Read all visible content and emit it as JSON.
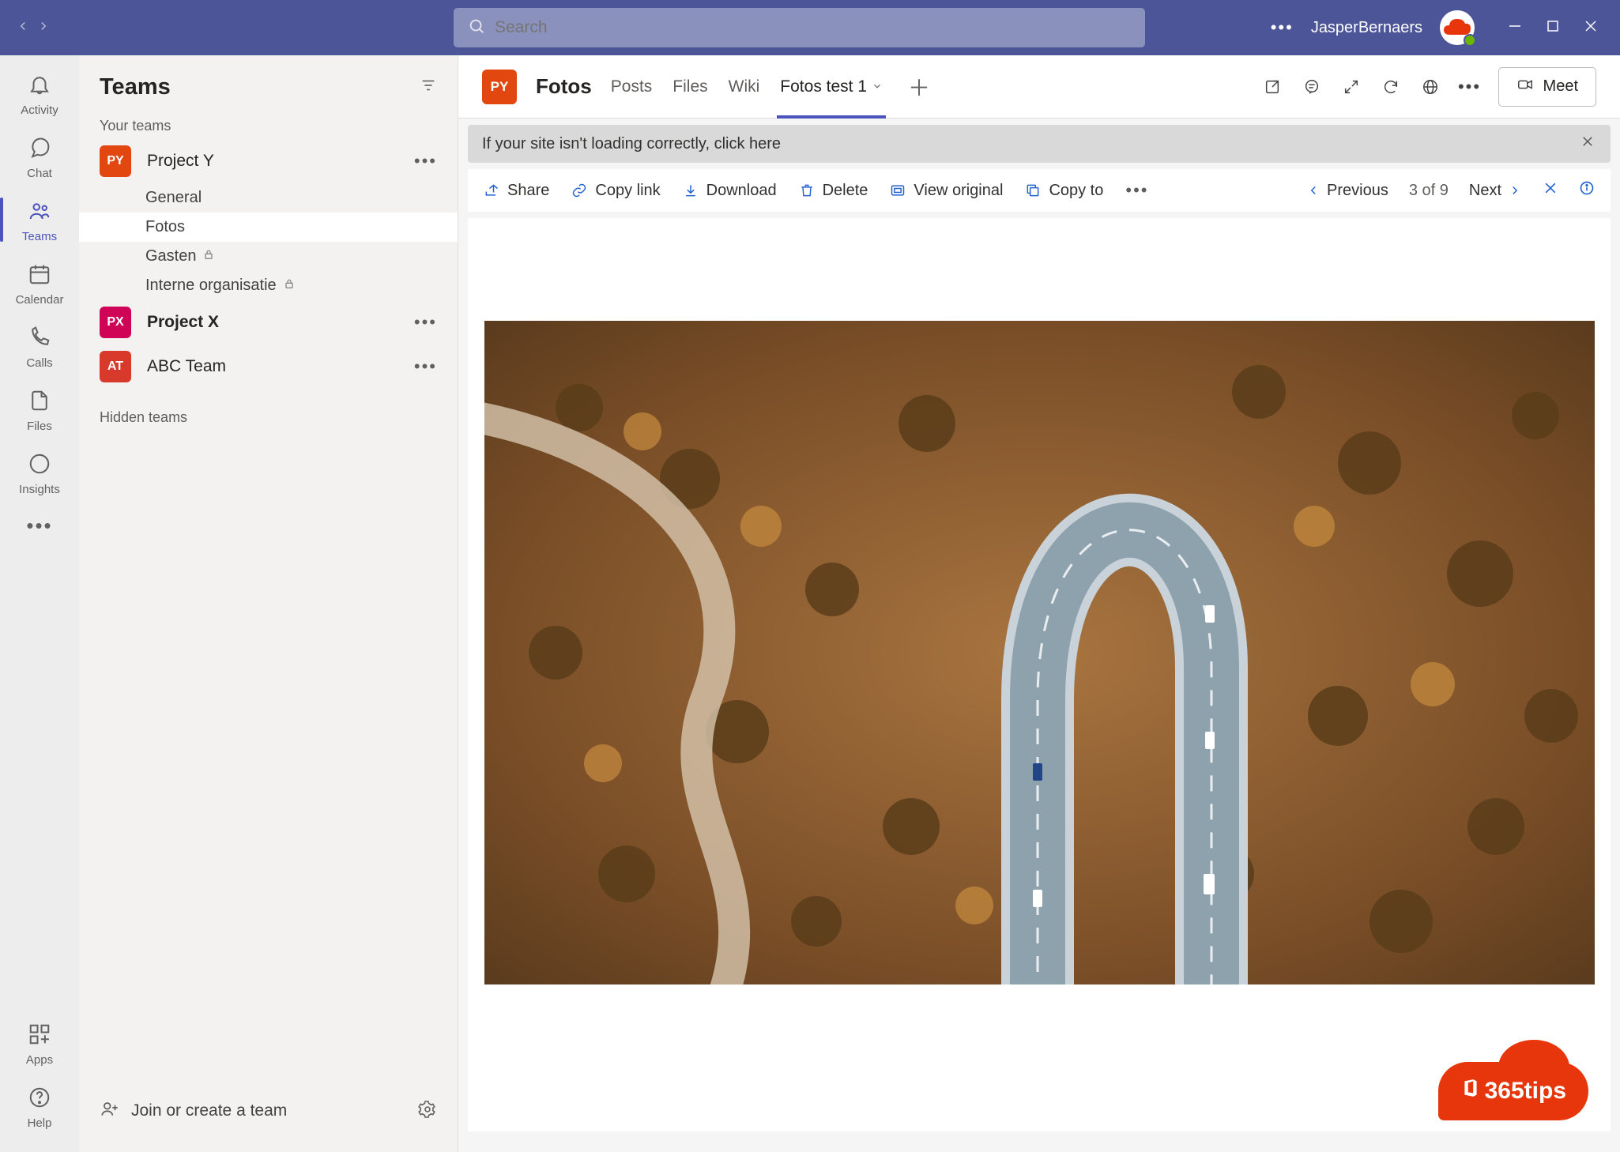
{
  "titlebar": {
    "search_placeholder": "Search",
    "user_name": "JasperBernaers"
  },
  "apprail": {
    "items": [
      {
        "label": "Activity",
        "icon": "bell"
      },
      {
        "label": "Chat",
        "icon": "chat"
      },
      {
        "label": "Teams",
        "icon": "teams",
        "selected": true
      },
      {
        "label": "Calendar",
        "icon": "calendar"
      },
      {
        "label": "Calls",
        "icon": "phone"
      },
      {
        "label": "Files",
        "icon": "file"
      },
      {
        "label": "Insights",
        "icon": "insights"
      }
    ],
    "bottom": [
      {
        "label": "Apps",
        "icon": "apps"
      },
      {
        "label": "Help",
        "icon": "help"
      }
    ]
  },
  "sidebar": {
    "title": "Teams",
    "your_teams_label": "Your teams",
    "hidden_teams_label": "Hidden teams",
    "teams": [
      {
        "name": "Project Y",
        "initials": "PY",
        "color": "#e2470f",
        "bold": false,
        "channels": [
          {
            "name": "General"
          },
          {
            "name": "Fotos",
            "selected": true
          },
          {
            "name": "Gasten",
            "private": true
          },
          {
            "name": "Interne organisatie",
            "private": true
          }
        ]
      },
      {
        "name": "Project X",
        "initials": "PX",
        "color": "#cf0457",
        "bold": true,
        "channels": []
      },
      {
        "name": "ABC Team",
        "initials": "AT",
        "color": "#d7392b",
        "bold": false,
        "channels": []
      }
    ],
    "footer": {
      "join_label": "Join or create a team"
    }
  },
  "channel_header": {
    "team_initials": "PY",
    "team_color": "#e2470f",
    "channel_name": "Fotos",
    "tabs": [
      {
        "label": "Posts"
      },
      {
        "label": "Files"
      },
      {
        "label": "Wiki"
      },
      {
        "label": "Fotos test 1",
        "active": true,
        "has_dropdown": true
      }
    ],
    "meet_label": "Meet"
  },
  "infobar": {
    "text": "If your site isn't loading correctly, click here"
  },
  "toolbar": {
    "share": "Share",
    "copy_link": "Copy link",
    "download": "Download",
    "delete": "Delete",
    "view_original": "View original",
    "copy_to": "Copy to",
    "previous": "Previous",
    "counter": "3 of 9",
    "next": "Next"
  },
  "logo": {
    "text": "365tips"
  }
}
